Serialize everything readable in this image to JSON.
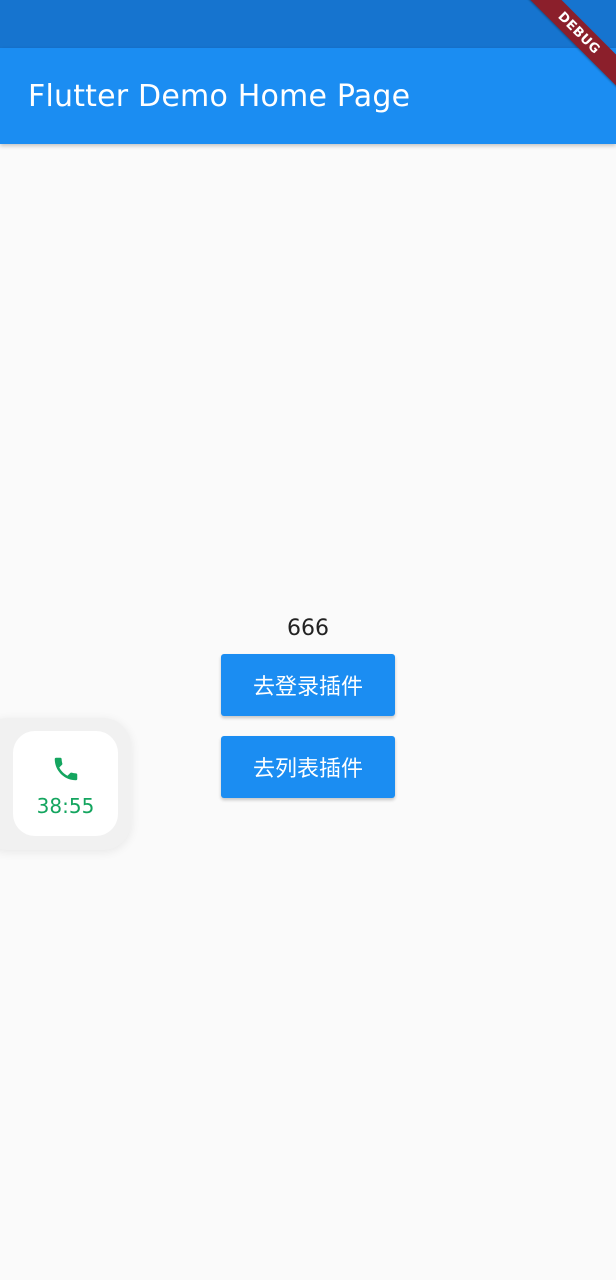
{
  "app_bar": {
    "title": "Flutter Demo Home Page"
  },
  "debug_banner": {
    "label": "DEBUG"
  },
  "main": {
    "counter": "666",
    "buttons": [
      {
        "label": "去登录插件"
      },
      {
        "label": "去列表插件"
      }
    ]
  },
  "floating_call": {
    "icon": "phone-icon",
    "time": "38:55"
  },
  "colors": {
    "status_bar": "#1674cf",
    "app_bar": "#1b8df2",
    "button": "#1b8df2",
    "call_green": "#14a55f",
    "debug_ribbon": "#8b1f2b",
    "background": "#fafafa"
  }
}
